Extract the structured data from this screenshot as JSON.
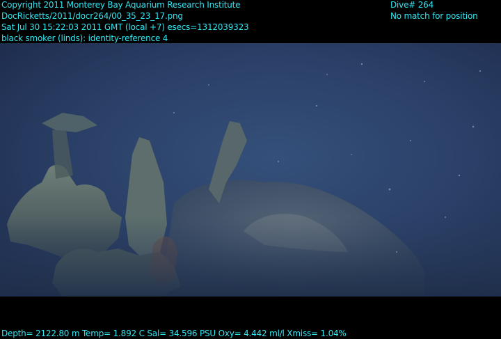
{
  "overlay": {
    "line1": "Copyright 2011 Monterey Bay Aquarium Research Institute",
    "line2": "DocRicketts/2011/docr264/00_35_23_17.png",
    "line3": "Sat Jul 30 15:22:03 2011 GMT (local +7)  esecs=1312039323",
    "line4": "black smoker (linds): identity-reference 4",
    "dive": "Dive# 264",
    "position": "No match for position",
    "telemetry": "Depth= 2122.80 m  Temp= 1.892 C  Sal= 34.596 PSU  Oxy= 4.442 ml/l  Xmiss= 1.04%"
  },
  "colors": {
    "overlay_text": "#31e6f2",
    "water": "#2b3f66",
    "frame": "#000000"
  }
}
